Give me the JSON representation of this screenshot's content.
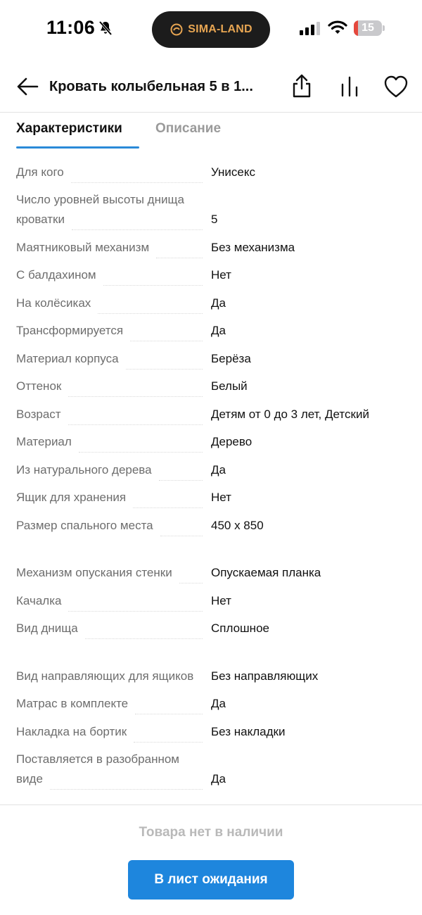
{
  "status_bar": {
    "time": "11:06",
    "island_text": "SIMA-LAND",
    "battery_level": "15",
    "battery_percent": 15,
    "battery_color": "#e5483d",
    "icons": [
      "bell-slash-icon",
      "signal-icon",
      "wifi-icon",
      "battery-icon"
    ]
  },
  "header": {
    "title": "Кровать колыбельная 5 в 1...",
    "icons": [
      "back-arrow-icon",
      "share-icon",
      "compare-chart-icon",
      "heart-icon"
    ]
  },
  "tabs": [
    {
      "label": "Характеристики",
      "active": true
    },
    {
      "label": "Описание",
      "active": false
    }
  ],
  "specs": [
    {
      "label": "Для кого",
      "value": "Унисекс"
    },
    {
      "label": "Число уровней высоты днища кроватки",
      "value": "5"
    },
    {
      "label": "Маятниковый механизм",
      "value": "Без механизма"
    },
    {
      "label": "С балдахином",
      "value": "Нет"
    },
    {
      "label": "На колёсиках",
      "value": "Да"
    },
    {
      "label": "Трансформируется",
      "value": "Да"
    },
    {
      "label": "Материал корпуса",
      "value": "Берёза"
    },
    {
      "label": "Оттенок",
      "value": "Белый"
    },
    {
      "label": "Возраст",
      "value": "Детям от 0 до 3 лет, Детский"
    },
    {
      "label": "Материал",
      "value": "Дерево"
    },
    {
      "label": "Из натурального дерева",
      "value": "Да"
    },
    {
      "label": "Ящик для хранения",
      "value": "Нет"
    },
    {
      "label": "Размер спального места",
      "value": "450 х 850"
    },
    {
      "label": "Механизм опускания стенки",
      "value": "Опускаемая планка"
    },
    {
      "label": "Качалка",
      "value": "Нет"
    },
    {
      "label": "Вид днища",
      "value": "Сплошное"
    },
    {
      "label": "Вид направляющих для ящиков",
      "value": "Без направляющих"
    },
    {
      "label": "Матрас в комплекте",
      "value": "Да"
    },
    {
      "label": "Накладка на бортик",
      "value": "Без накладки"
    },
    {
      "label": "Поставляется в разобранном виде",
      "value": "Да"
    }
  ],
  "footer": {
    "stock_text": "Товара нет в наличии",
    "button_label": "В лист ожидания"
  },
  "colors": {
    "accent": "#1e86dd",
    "tab_underline": "#2a8ad8",
    "label_gray": "#6d6d6d",
    "disabled_text": "#b9b9b9",
    "island_text": "#e7a552"
  }
}
